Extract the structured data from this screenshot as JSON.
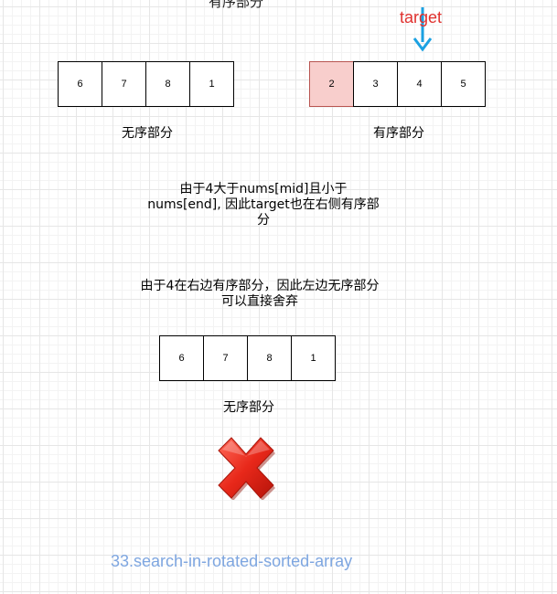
{
  "top": {
    "unsorted_cells": [
      "6",
      "7",
      "8",
      "1"
    ],
    "sorted_cells": [
      "2",
      "3",
      "4",
      "5"
    ],
    "unsorted_label": "无序部分",
    "sorted_label": "有序部分",
    "target_label": "target",
    "target_pointer_color": "#1ba1e2",
    "highlight_fill": "#f8cecc"
  },
  "explanations": {
    "reason_1": "由于4大于nums[mid]且小于nums[end], 因此target也在右侧有序部分",
    "reason_2": "由于4在右边有序部分，因此左边无序部分可以直接舍弃"
  },
  "discarded": {
    "cells": [
      "6",
      "7",
      "8",
      "1"
    ],
    "label": "无序部分",
    "cross_icon": "red-cross-icon"
  },
  "footer": {
    "caption": "33.search-in-rotated-sorted-array"
  }
}
